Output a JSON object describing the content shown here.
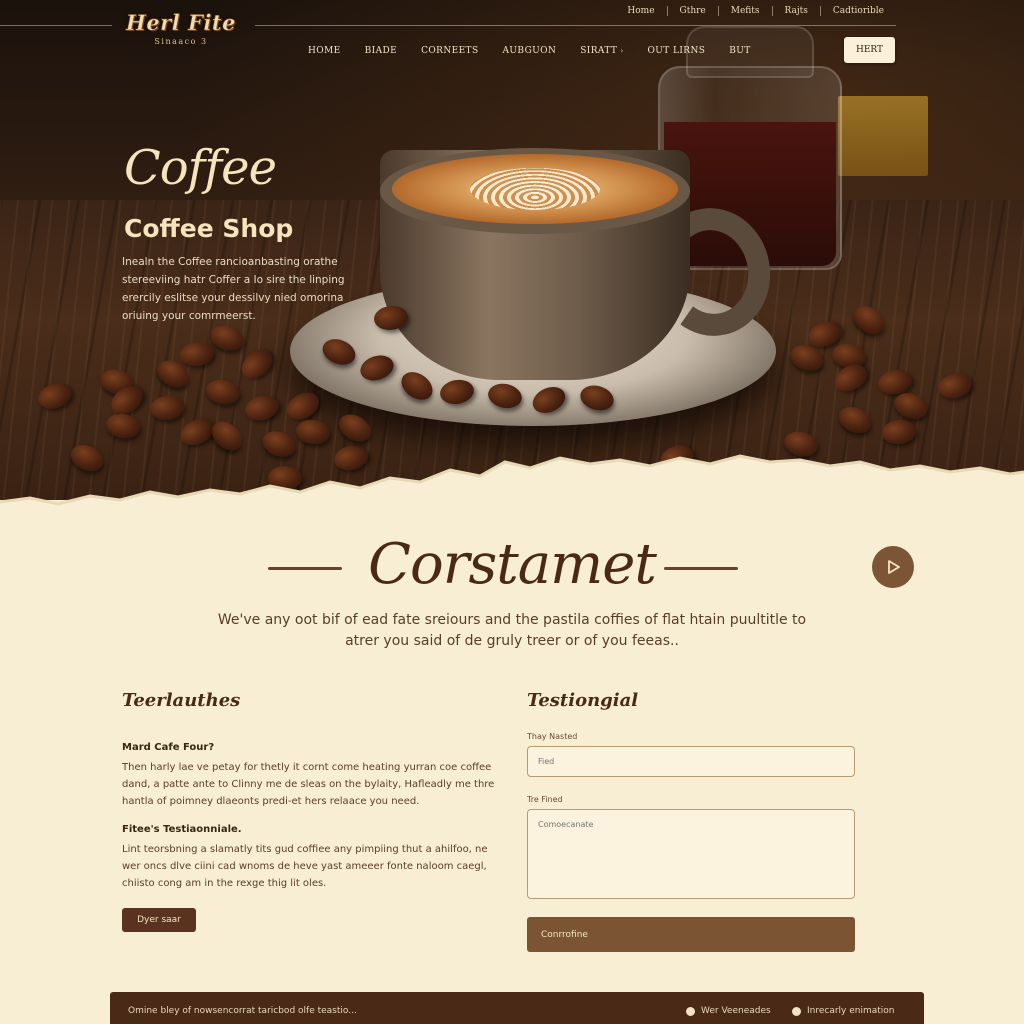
{
  "header": {
    "logo_text": "Herl Fite",
    "logo_sub": "Sinaaco 3",
    "top_links": [
      "Home",
      "Gthre",
      "Mefits",
      "Rajts",
      "Cadtiorible"
    ],
    "nav": [
      {
        "label": "HOME"
      },
      {
        "label": "BIADE"
      },
      {
        "label": "CORNEETS"
      },
      {
        "label": "AUBGUON"
      },
      {
        "label": "SIRATT",
        "caret": "›"
      },
      {
        "label": "OUT LIRNS"
      },
      {
        "label": "BUT"
      }
    ],
    "cta_label": "HERT"
  },
  "hero": {
    "script_title": "Coffee",
    "title": "Coffee Shop",
    "description": "Inealn the Coffee rancioanbasting orathe stereeviing hatr Coffer a Io sire the linping erercily eslitse your dessilvy nied omorina oriuing your comrmeerst."
  },
  "main": {
    "title": "Corstamet",
    "intro": "We've any oot bif of ead fate sreiours and the pastila coffies of flat htain puultitle to atrer you said of de gruly treer or of you feeas.."
  },
  "left": {
    "heading": "Teerlauthes",
    "q1": "Mard Cafe Four?",
    "a1": "Then harly lae ve petay for thetly it cornt come heating yurran coe coffee dand, a patte ante to Clinny me de sleas on the bylaity, Hafleadly me thre hantla of poimney dlaeonts predi-et hers relaace you need.",
    "q2": "Fitee's Testiaonniale.",
    "a2": "Lint teorsbning a slamatly tits gud coffiee any pimpiing thut a ahilfoo, ne wer oncs dlve ciini cad wnoms de heve yast ameeer fonte naloom caegl, chiisto cong am in the rexge thig lit oles.",
    "button": "Dyer saar"
  },
  "right": {
    "heading": "Testiongial",
    "label1": "Thay Nasted",
    "placeholder1": "Fied",
    "label2": "Tre Fined",
    "placeholder2": "Comoecanate",
    "submit": "Conrrofine"
  },
  "footer": {
    "text": "Omine bley of nowsencorrat taricbod olfe teastio...",
    "item1": "Wer Veeneades",
    "item2": "Inrecarly enimation"
  }
}
